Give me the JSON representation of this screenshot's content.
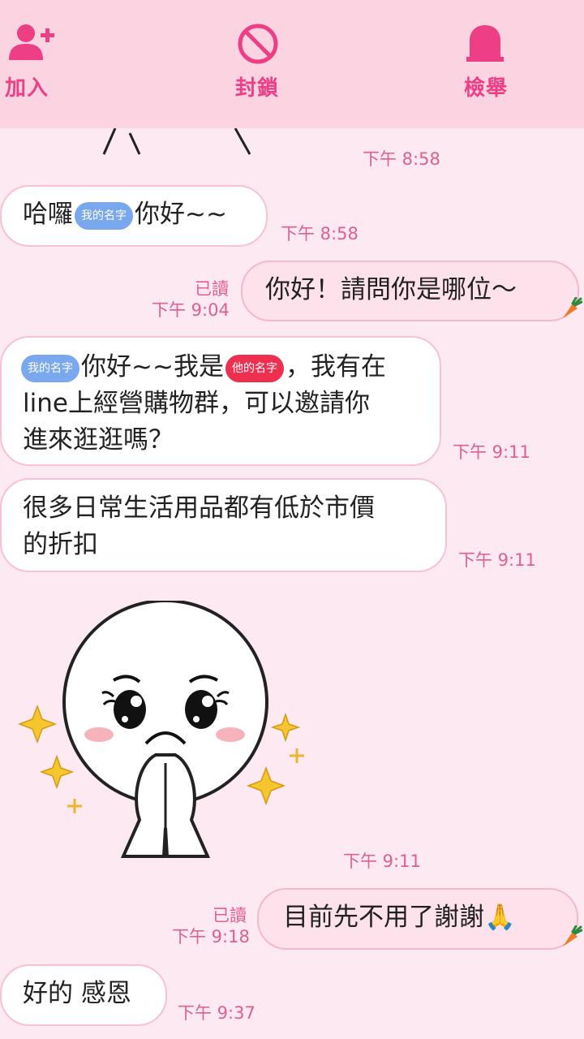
{
  "header": {
    "add_label": "加入",
    "block_label": "封鎖",
    "report_label": "檢舉"
  },
  "messages": [
    {
      "side": "in",
      "parts": [
        "哈囉",
        {
          "tag": "我的名字"
        },
        "你好~~"
      ],
      "time": "下午 8:58"
    },
    {
      "side": "out",
      "text": "你好！請問你是哪位～",
      "read": "已讀",
      "time": "下午 9:04"
    },
    {
      "side": "in",
      "line1_a": "你好~~我是",
      "line1_b": "，我有在",
      "line2": "line上經營購物群，可以邀請你",
      "line3": "進來逛逛嗎？",
      "my_tag": "我的名字",
      "his_tag": "他的名字",
      "time": "下午 9:11"
    },
    {
      "side": "in",
      "line1": "很多日常生活用品都有低於市價",
      "line2": "的折扣",
      "time": "下午 9:11"
    },
    {
      "side": "in",
      "type": "sticker",
      "time": "下午 9:11"
    },
    {
      "side": "out",
      "text": "目前先不用了謝謝",
      "emoji": "🙏",
      "read": "已讀",
      "time": "下午 9:18"
    },
    {
      "side": "in",
      "text": "好的 感恩",
      "time": "下午 9:37"
    }
  ],
  "top_time": "下午 8:58",
  "colors": {
    "accent": "#ee3e86",
    "topbar": "#fbd3e1",
    "background": "#fde9f1",
    "bubble_out": "#fde2ec"
  }
}
